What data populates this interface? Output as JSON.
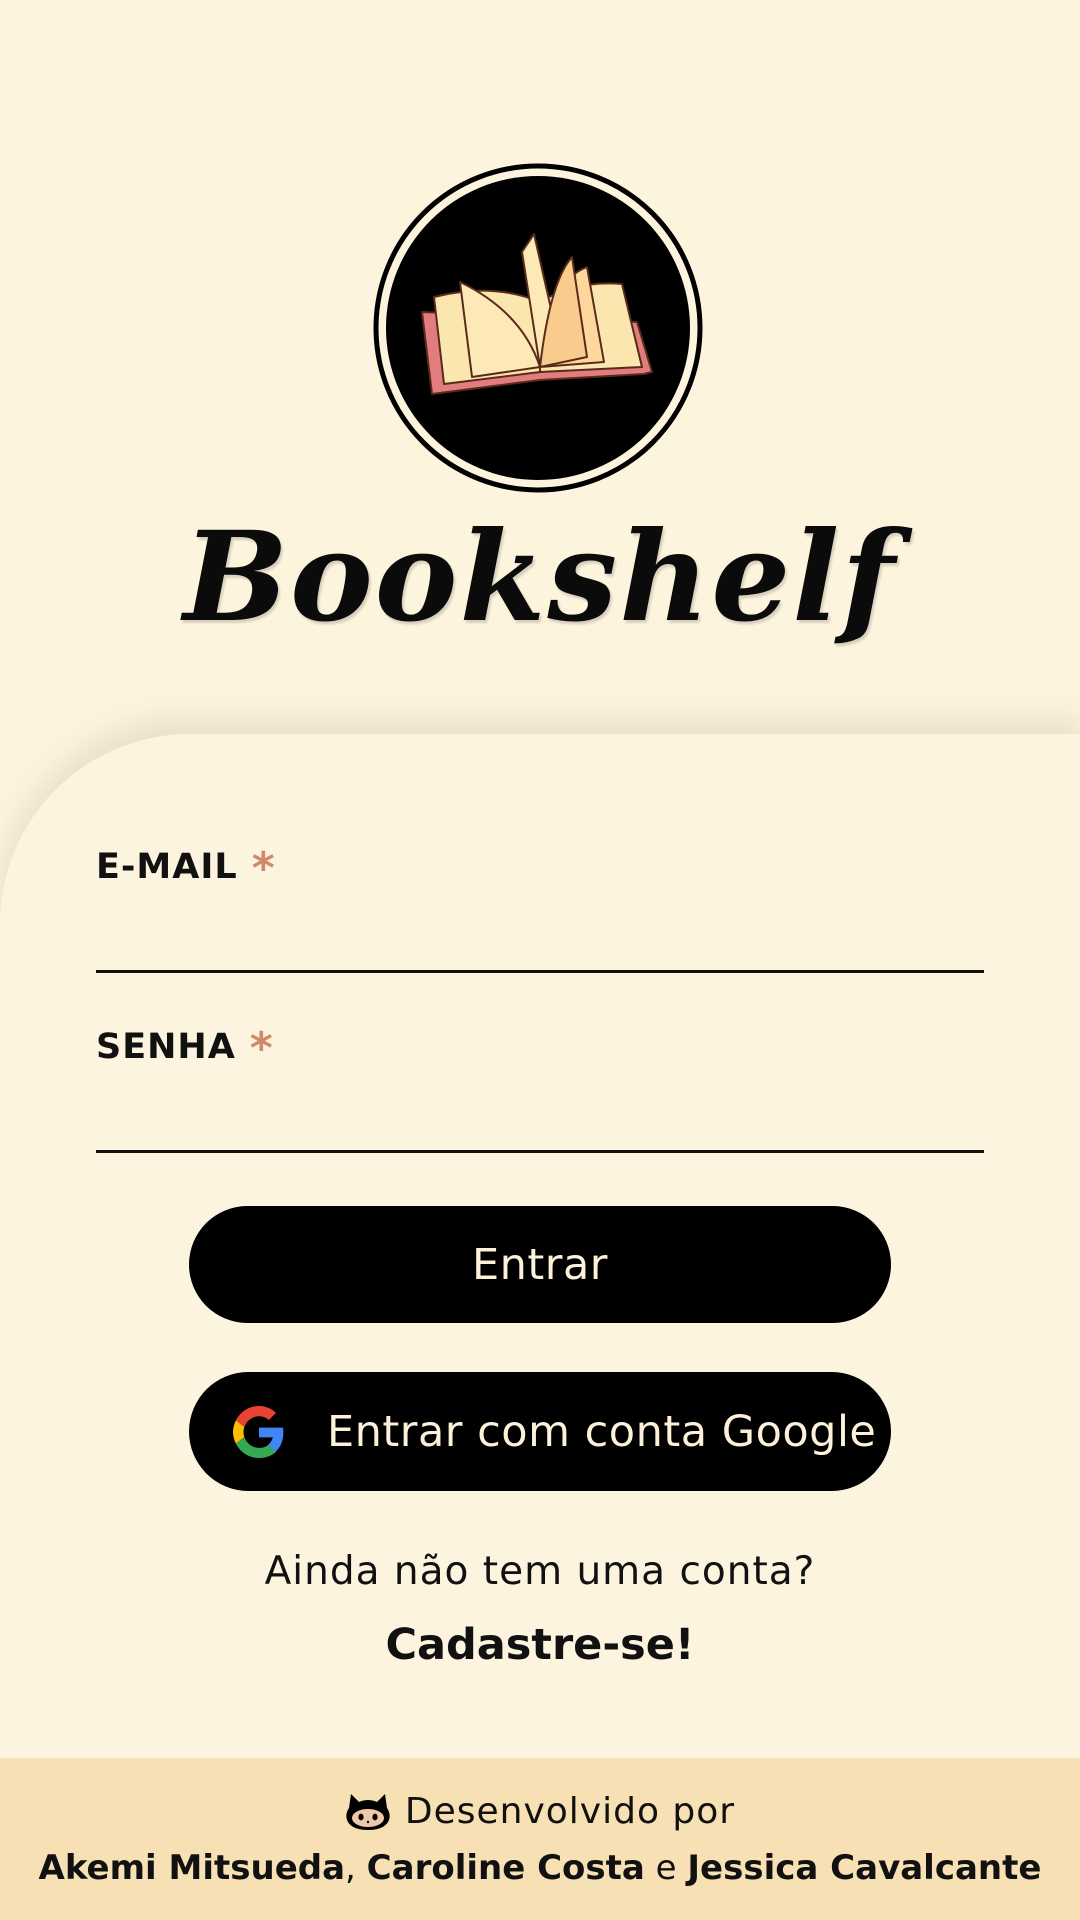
{
  "app": {
    "brand_name": "Bookshelf"
  },
  "icons": {
    "logo": "open-book-icon",
    "google": "google-g-icon",
    "developer": "github-octocat-icon"
  },
  "form": {
    "email_label": "E-MAIL",
    "password_label": "SENHA",
    "required_marker": "*",
    "email_value": "",
    "password_value": ""
  },
  "buttons": {
    "login_label": "Entrar",
    "google_label": "Entrar com conta Google"
  },
  "signup": {
    "question": "Ainda não tem uma conta?",
    "link_label": "Cadastre-se!"
  },
  "footer": {
    "developed_by": "Desenvolvido por",
    "author1": "Akemi Mitsueda",
    "separator1": ", ",
    "author2": "Caroline Costa",
    "separator2": " e ",
    "author3": "Jessica Cavalcante"
  },
  "colors": {
    "background": "#fdf4de",
    "footer_bg": "#f7e0b3",
    "button_bg": "#000000",
    "button_text": "#fdf1da",
    "required_marker": "#d08a68"
  }
}
